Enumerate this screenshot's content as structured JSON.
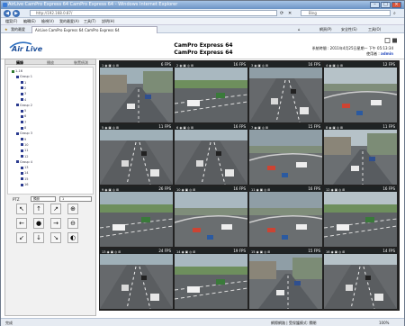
{
  "window": {
    "title": "AirLive CamPro Express 64 CamPro Express 64 - Windows Internet Explorer",
    "min_icon": "minimize-icon",
    "max_icon": "maximize-icon",
    "close_icon": "close-icon"
  },
  "browser": {
    "address": "http://192.168.0.87/",
    "search_placeholder": "Bing",
    "menu": [
      "檔案(F)",
      "編輯(E)",
      "檢視(V)",
      "我的最愛(A)",
      "工具(T)",
      "說明(H)"
    ],
    "fav_label": "我的最愛",
    "tab_title": "AirLive CamPro Express 64 CamPro Express 64",
    "toolbar": [
      "網頁(P)",
      "安全性(S)",
      "工具(O)"
    ]
  },
  "app": {
    "logo": "Air Live",
    "title1": "CamPro Express 64",
    "title2": "CamPro Express 64",
    "systime": "系統時間 : 2011年4月25日星期一 下午 05:13:34",
    "user_label": "使用者 :",
    "user": "admin"
  },
  "sidebar": {
    "tabs": [
      "攝錄",
      "播放",
      "裝置偵測"
    ],
    "tree": [
      {
        "label": "1-16",
        "level": 0,
        "color": "#2f7a2f"
      },
      {
        "label": "Group 1",
        "level": 1,
        "color": "#2a3a8f"
      },
      {
        "label": "1",
        "level": 2,
        "color": "#2a3a8f"
      },
      {
        "label": "2",
        "level": 2,
        "color": "#2a3a8f"
      },
      {
        "label": "3",
        "level": 2,
        "color": "#2a3a8f"
      },
      {
        "label": "4",
        "level": 2,
        "color": "#2a3a8f"
      },
      {
        "label": "Group 2",
        "level": 1,
        "color": "#2a3a8f"
      },
      {
        "label": "5",
        "level": 2,
        "color": "#2a3a8f"
      },
      {
        "label": "6",
        "level": 2,
        "color": "#2a3a8f"
      },
      {
        "label": "7",
        "level": 2,
        "color": "#2a3a8f"
      },
      {
        "label": "8",
        "level": 2,
        "color": "#2a3a8f"
      },
      {
        "label": "Group 3",
        "level": 1,
        "color": "#2a3a8f"
      },
      {
        "label": "9",
        "level": 2,
        "color": "#2a3a8f"
      },
      {
        "label": "10",
        "level": 2,
        "color": "#2a3a8f"
      },
      {
        "label": "11",
        "level": 2,
        "color": "#2a3a8f"
      },
      {
        "label": "12",
        "level": 2,
        "color": "#2a3a8f"
      },
      {
        "label": "Group 4",
        "level": 1,
        "color": "#2a3a8f"
      },
      {
        "label": "13",
        "level": 2,
        "color": "#2a3a8f"
      },
      {
        "label": "14",
        "level": 2,
        "color": "#2a3a8f"
      },
      {
        "label": "15",
        "level": 2,
        "color": "#2a3a8f"
      },
      {
        "label": "16",
        "level": 2,
        "color": "#2a3a8f"
      }
    ],
    "ptz_label": "PTZ",
    "ptz_sel1": "預設",
    "ptz_sel2": "1",
    "ptz_buttons": [
      "↖",
      "↑",
      "↗",
      "⊕",
      "←",
      "●",
      "→",
      "⊖",
      "↙",
      "↓",
      "↘",
      "◐"
    ]
  },
  "cameras": [
    {
      "fps": "6 FPS",
      "ctrl": "1 ◉ ▣ ◎ ⊞"
    },
    {
      "fps": "16 FPS",
      "ctrl": "2 ◉ ▣ ◎ ⊞"
    },
    {
      "fps": "16 FPS",
      "ctrl": "3 ◉ ▣ ◎ ⊞"
    },
    {
      "fps": "12 FPS",
      "ctrl": "4 ◉ ▣ ◎ ⊞"
    },
    {
      "fps": "11 FPS",
      "ctrl": "5 ◉ ▣ ◎ ⊞"
    },
    {
      "fps": "16 FPS",
      "ctrl": "6 ◉ ▣ ◎ ⊞"
    },
    {
      "fps": "15 FPS",
      "ctrl": "7 ◉ ▣ ◎ ⊞"
    },
    {
      "fps": "11 FPS",
      "ctrl": "8 ◉ ▣ ◎ ⊞"
    },
    {
      "fps": "26 FPS",
      "ctrl": "9 ◉ ▣ ◎ ⊞"
    },
    {
      "fps": "16 FPS",
      "ctrl": "10 ◉ ▣ ◎ ⊞"
    },
    {
      "fps": "16 FPS",
      "ctrl": "11 ◉ ▣ ◎ ⊞"
    },
    {
      "fps": "16 FPS",
      "ctrl": "12 ◉ ▣ ◎ ⊞"
    },
    {
      "fps": "24 FPS",
      "ctrl": "13 ◉ ▣ ◎ ⊞"
    },
    {
      "fps": "19 FPS",
      "ctrl": "14 ◉ ▣ ◎ ⊞"
    },
    {
      "fps": "15 FPS",
      "ctrl": "15 ◉ ▣ ◎ ⊞"
    },
    {
      "fps": "14 FPS",
      "ctrl": "16 ◉ ▣ ◎ ⊞"
    }
  ],
  "status": {
    "left": "完成",
    "zone": "網際網路 | 受保護模式: 關閉",
    "zoom": "100%"
  }
}
